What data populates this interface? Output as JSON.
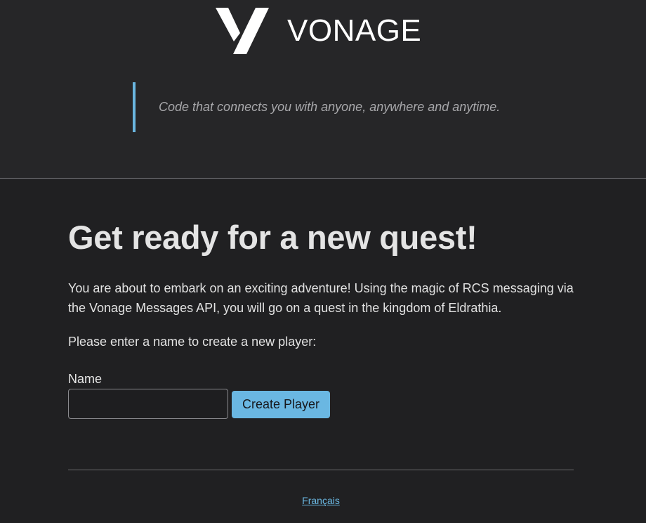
{
  "header": {
    "brand": "VONAGE",
    "logo_icon": "vonage-v-logo",
    "tagline": "Code that connects you with anyone, anywhere and anytime."
  },
  "main": {
    "title": "Get ready for a new quest!",
    "intro": "You are about to embark on an exciting adventure! Using the magic of RCS messaging via the Vonage Messages API, you will go on a quest in the kingdom of Eldrathia.",
    "prompt": "Please enter a name to create a new player:",
    "form": {
      "name_label": "Name",
      "name_value": "",
      "submit_label": "Create Player"
    }
  },
  "footer": {
    "language_link": "Français"
  },
  "colors": {
    "accent": "#6ab6e0",
    "background": "#202022",
    "header_background": "#262628"
  }
}
